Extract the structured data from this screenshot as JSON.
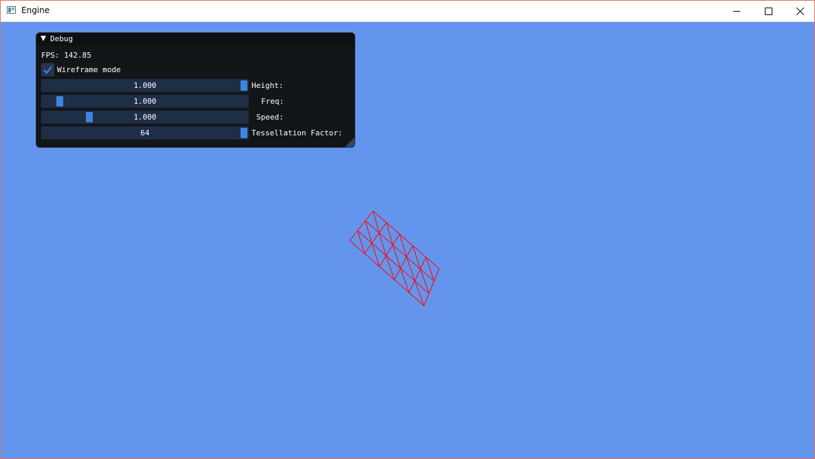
{
  "window": {
    "title": "Engine",
    "background_color": "#6495ED",
    "icons": {
      "app": "app-window-icon",
      "minimize": "minimize-icon",
      "maximize": "maximize-icon",
      "close": "close-icon"
    }
  },
  "debug_panel": {
    "title": "Debug",
    "collapse_icon": "triangle-down-icon",
    "fps_text": "FPS: 142.85",
    "wireframe": {
      "label": "Wireframe mode",
      "checked": true,
      "check_icon": "checkmark-icon"
    },
    "sliders": [
      {
        "label": "Height:",
        "value": "1.000",
        "fraction": 1.0
      },
      {
        "label": "Freq:",
        "value": "1.000",
        "fraction": 0.07
      },
      {
        "label": "Speed:",
        "value": "1.000",
        "fraction": 0.22
      },
      {
        "label": "Tessellation Factor:",
        "value": "64",
        "fraction": 1.0
      }
    ],
    "accent_color": "#3D85E0",
    "resize_icon": "resize-grip-icon"
  },
  "scene": {
    "mesh": {
      "type": "wireframe-grid",
      "color": "#FF0000"
    }
  }
}
